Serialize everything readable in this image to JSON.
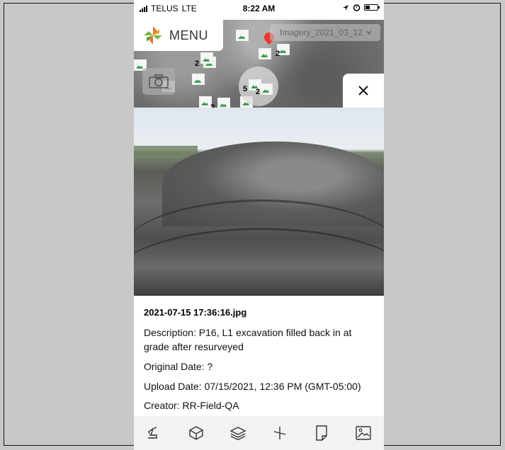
{
  "status_bar": {
    "carrier": "TELUS",
    "network": "LTE",
    "time": "8:22 AM"
  },
  "map": {
    "menu_label": "MENU",
    "imagery_select": "Imagery_2021_03_12",
    "cluster_counts": [
      "2",
      "2",
      "5",
      "2",
      "2"
    ]
  },
  "photo_details": {
    "filename": "2021-07-15 17:36:16.jpg",
    "description": "Description: P16, L1 excavation filled back in at grade after resurveyed",
    "original_date": "Original Date: ?",
    "upload_date": "Upload Date: 07/15/2021, 12:36 PM (GMT-05:00)",
    "creator": "Creator: RR-Field-QA"
  },
  "toolbar": {
    "icons": [
      "excavator-icon",
      "cube-icon",
      "layers-icon",
      "measure-icon",
      "document-icon",
      "image-icon"
    ]
  },
  "colors": {
    "pin": "#e8392b",
    "thumb_green": "#3aa04a",
    "logo_orange": "#e8792b",
    "logo_green": "#7ab648"
  }
}
